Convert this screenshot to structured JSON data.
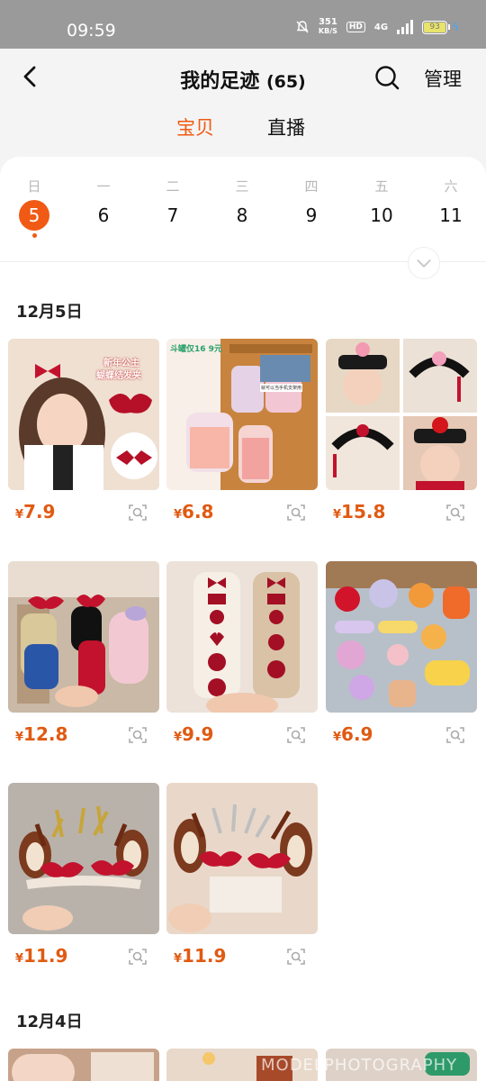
{
  "status_bar": {
    "time": "09:59",
    "net_speed_value": "351",
    "net_speed_unit": "KB/S",
    "hd": "HD",
    "network": "4G",
    "battery": "93"
  },
  "header": {
    "title": "我的足迹",
    "count": "(65)",
    "manage_label": "管理"
  },
  "tabs": [
    {
      "label": "宝贝"
    },
    {
      "label": "直播"
    }
  ],
  "calendar": {
    "days": [
      {
        "weekday": "日",
        "date": "5",
        "selected": true
      },
      {
        "weekday": "一",
        "date": "6"
      },
      {
        "weekday": "二",
        "date": "7"
      },
      {
        "weekday": "三",
        "date": "8"
      },
      {
        "weekday": "四",
        "date": "9"
      },
      {
        "weekday": "五",
        "date": "10"
      },
      {
        "weekday": "六",
        "date": "11"
      }
    ]
  },
  "sections": [
    {
      "date": "12月5日",
      "items": [
        {
          "price": "7.9",
          "image": "hair bow clips",
          "image_text": [
            "新年公主",
            "蝴蝶结发夹"
          ]
        },
        {
          "price": "6.8",
          "image": "hair ties in jars",
          "image_text": [
            "斗罐仅16 9元",
            "就可以当手机支架用"
          ]
        },
        {
          "price": "15.8",
          "image": "qing princess headbands"
        },
        {
          "price": "12.8",
          "image": "plush hair clips"
        },
        {
          "price": "9.9",
          "image": "red velvet hair clips"
        },
        {
          "price": "6.9",
          "image": "flower hair clips"
        },
        {
          "price": "11.9",
          "image": "reindeer antler headband"
        },
        {
          "price": "11.9",
          "image": "reindeer antler headband"
        }
      ]
    },
    {
      "date": "12月4日"
    }
  ],
  "currency": "¥",
  "watermark": "MODELPHOTOGRAPHY",
  "colors": {
    "accent": "#f05a14",
    "price": "#e05a12",
    "status_bar": "#9a9a9a"
  }
}
